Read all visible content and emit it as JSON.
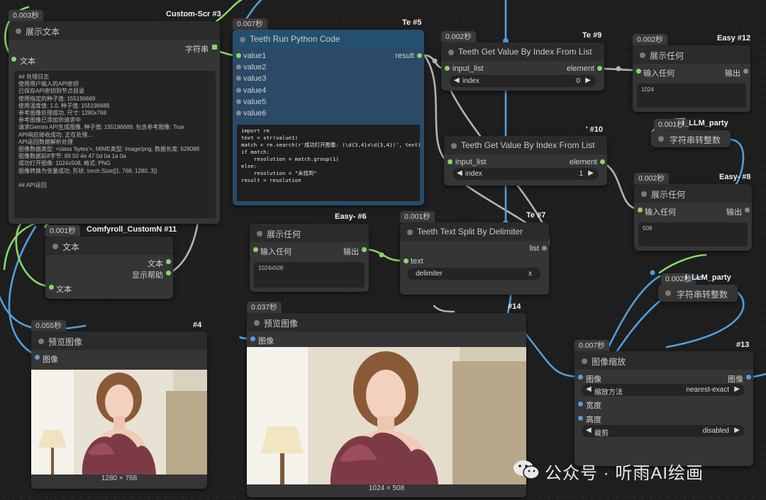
{
  "nodes": {
    "n3": {
      "timing": "0.003秒",
      "tag": "Custom-Scr #3",
      "title": "展示文本",
      "output_label": "字符串",
      "input_label": "文本",
      "log": "## 处理日志\n使用用户输入的API密钥\n已保存API密钥到节点目录\n使用指定的种子值: 155196689\n使用温度值: 1.0, 种子值: 155196689\n参考图像处理成功, 尺寸: 1280x768\n参考图像已添加到请求中\n请求Gemini API生成图像, 种子值: 155196689, 包含参考图像: True\nAPI响应接收成功, 正在处理...\nAPI返回数据解析处理\n图像数据类型: <class 'bytes'>, MIME类型: image/png, 数据长度: 628088\n图像数据前8字节: 89 50 4e 47 0d 0a 1a 0a\n成功打开图像: 1024x508, 格式: PNG\n图像转换为张量成功, 形状: torch.Size([1, 768, 1280, 3])\n\n## API返回"
    },
    "n5": {
      "timing": "0.007秒",
      "tag": "Te #5",
      "title": "Teeth Run Python Code",
      "output_label": "result",
      "inputs": [
        "value1",
        "value2",
        "value3",
        "value4",
        "value5",
        "value6"
      ],
      "code": "import re\ntext = str(value1)\nmatch = re.search(r'成功打开图像: (\\d{3,4}x\\d{3,4})', text)\nif match:\n    resolution = match.group(1)\nelse:\n    resolution = \"未找到\"\nresult = resolution"
    },
    "n9": {
      "timing": "0.002秒",
      "tag": "Te #9",
      "title": "Teeth Get Value By Index From List",
      "input_label": "input_list",
      "output_label": "element",
      "widget_label": "index",
      "widget_value": "0"
    },
    "n10": {
      "tag": "' #10",
      "title": "Teeth Get Value By Index From List",
      "input_label": "input_list",
      "output_label": "element",
      "widget_label": "index",
      "widget_value": "1"
    },
    "n12": {
      "timing": "0.002秒",
      "tag": "Easy #12",
      "title": "展示任何",
      "input_label": "输入任何",
      "output_label": "输出",
      "value": "1024"
    },
    "n8": {
      "timing": "0.002秒",
      "tag": "Easy- #8",
      "title": "展示任何",
      "input_label": "输入任何",
      "output_label": "输出",
      "value": "508"
    },
    "n6": {
      "tag": "Easy- #6",
      "title": "展示任何",
      "input_label": "输入任何",
      "output_label": "输出",
      "value": "1024x508"
    },
    "n7": {
      "timing": "0.001秒",
      "tag": "Te #7",
      "title": "Teeth Text Split By Delimiter",
      "input_label": "text",
      "output_label": "list",
      "widget_label": "delimiter",
      "widget_value": "x"
    },
    "n11": {
      "timing": "0.001秒",
      "tag": "Comfyroll_CustomN #11",
      "title": "文本",
      "input_label": "文本",
      "out1": "文本",
      "out2": "显示帮助"
    },
    "n4": {
      "timing": "0.055秒",
      "tag": "#4",
      "title": "预览图像",
      "input_label": "图像",
      "caption": "1280 × 768"
    },
    "n14": {
      "timing": "0.037秒",
      "tag": "#14",
      "title": "预览图像",
      "input_label": "图像",
      "caption": "1024 × 508"
    },
    "n13": {
      "timing": "0.007秒",
      "tag": "#13",
      "title": "图像缩放",
      "in_image": "图像",
      "out_image": "图像",
      "w1_label": "缩放方法",
      "w1_value": "nearest-exact",
      "width_label": "宽度",
      "height_label": "高度",
      "w2_label": "裁剪",
      "w2_value": "disabled"
    },
    "c1": {
      "timing": "0.001秒",
      "tag": "i_LLM_party",
      "title": "字符串转整数"
    },
    "c2": {
      "timing": "0.002秒",
      "tag": "i_LLM_party",
      "title": "字符串转整数"
    }
  },
  "watermark": "公众号 · 听雨AI绘画",
  "colors": {
    "wire_green": "#8ad66a",
    "wire_blue": "#4f9fe0",
    "wire_gray": "#b4b4b4",
    "node_blue": "#2a4a68"
  }
}
